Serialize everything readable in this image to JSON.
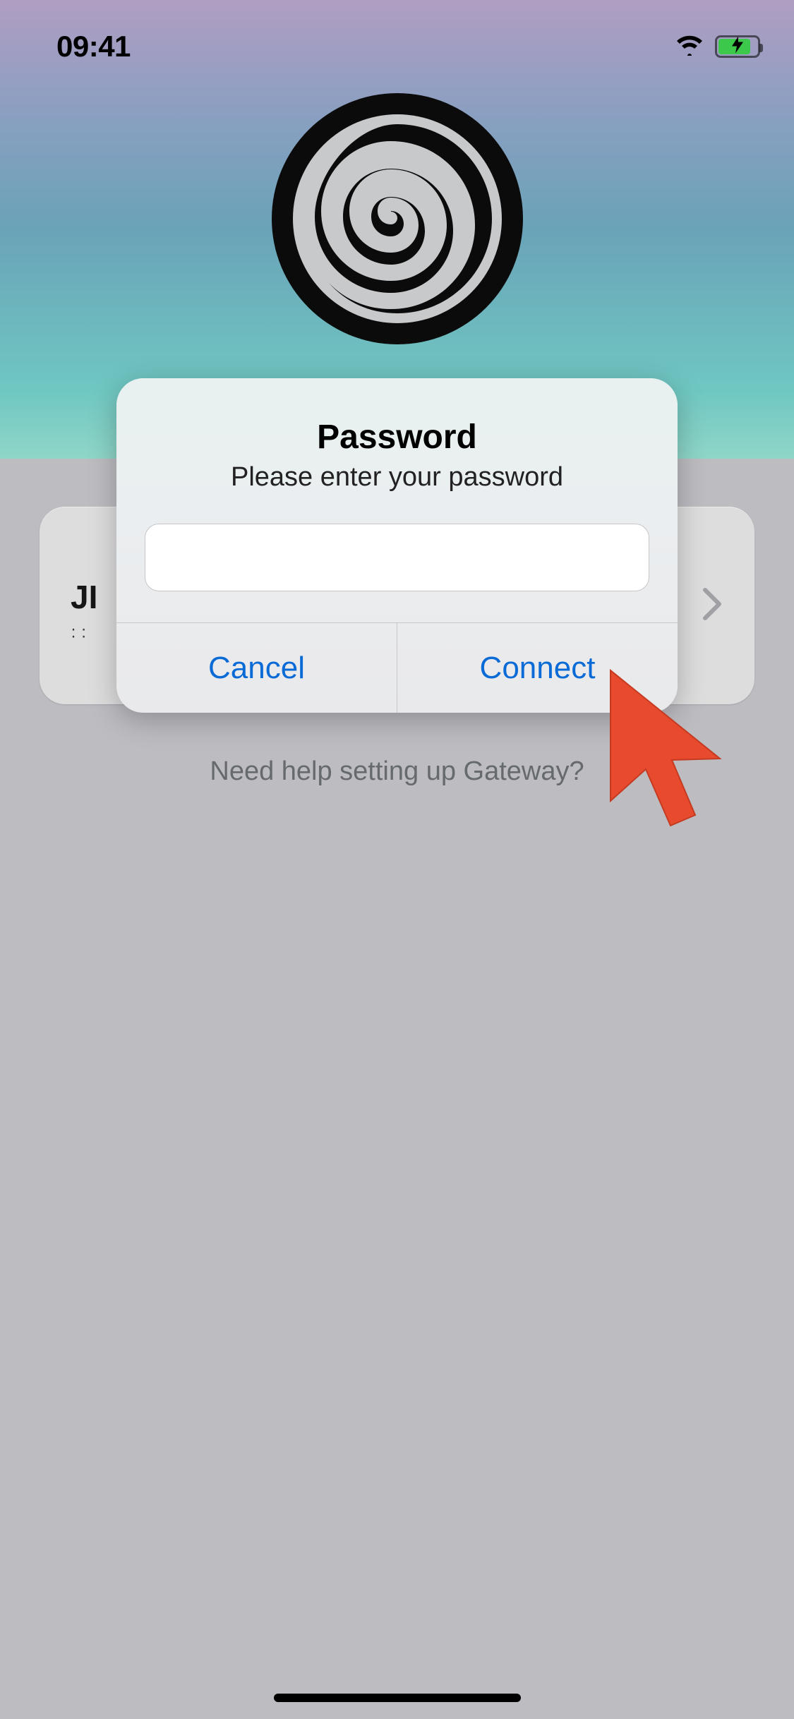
{
  "status_bar": {
    "time": "09:41"
  },
  "background_card": {
    "title_fragment": "JI"
  },
  "help_link": "Need help setting up Gateway?",
  "modal": {
    "title": "Password",
    "subtitle": "Please enter your password",
    "input_value": "",
    "cancel_label": "Cancel",
    "connect_label": "Connect"
  }
}
